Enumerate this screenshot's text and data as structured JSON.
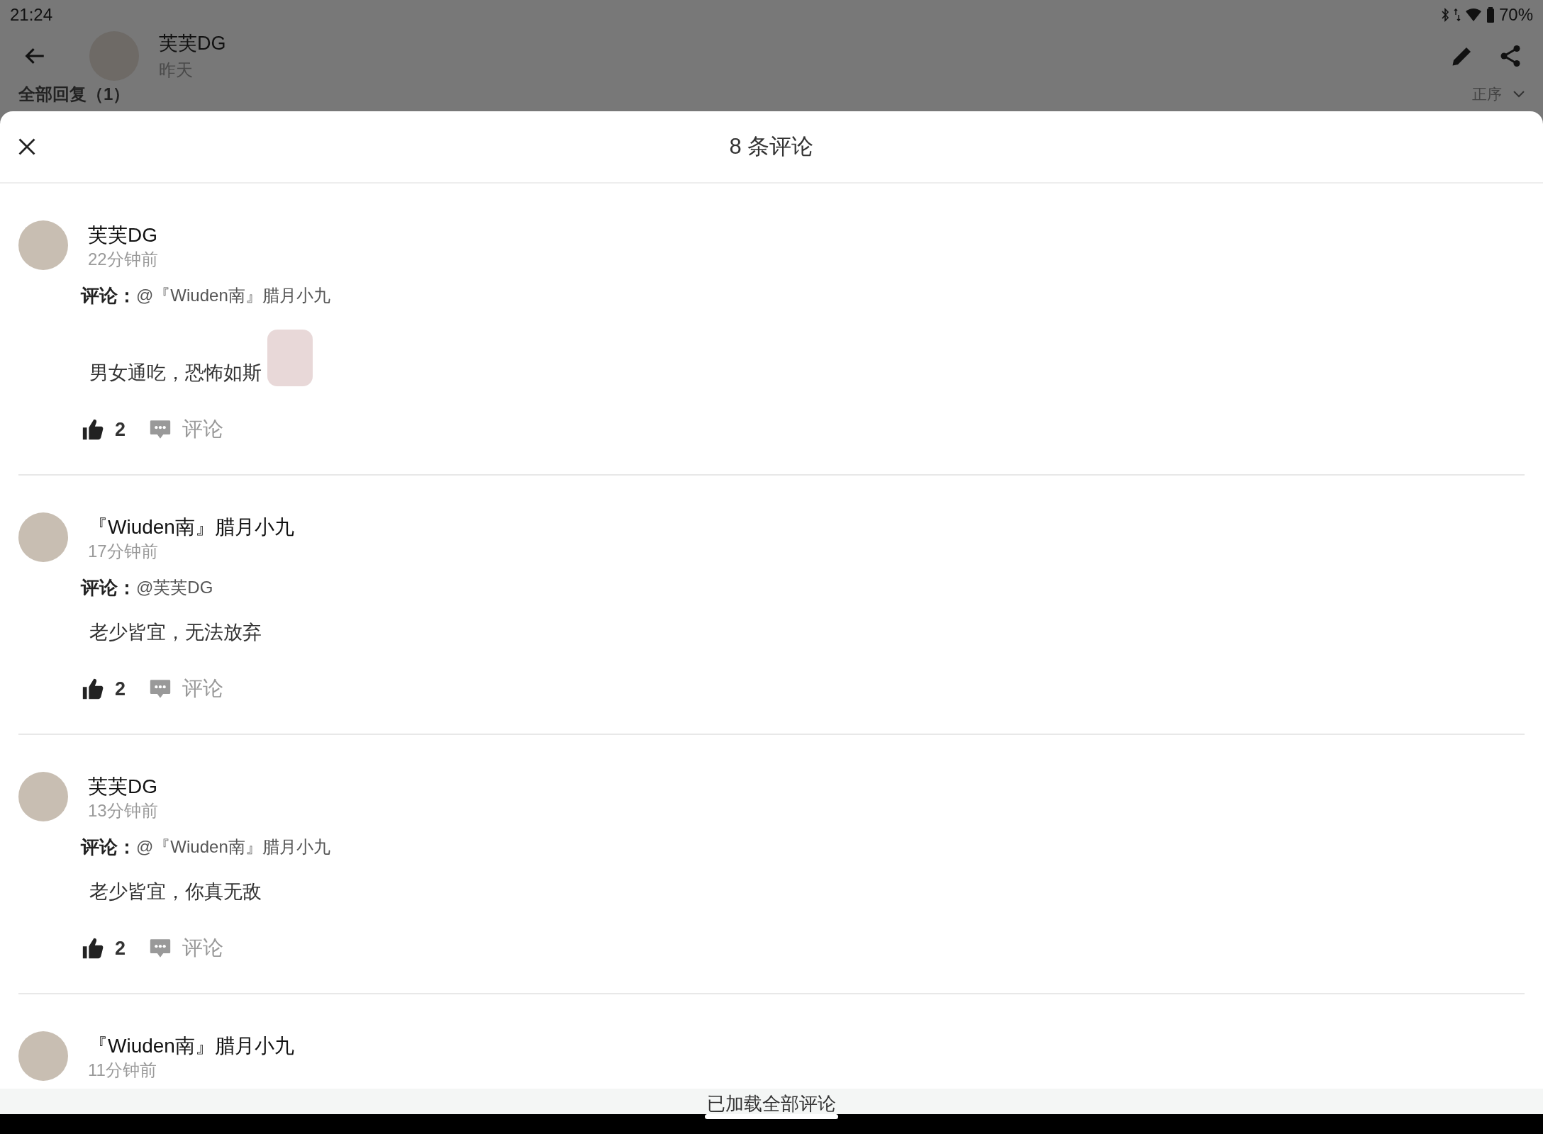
{
  "status_bar": {
    "time": "21:24",
    "battery": "70%"
  },
  "post_header": {
    "author": "芙芙DG",
    "date": "昨天"
  },
  "background_row": {
    "label": "全部回复（1）",
    "sort": "正序"
  },
  "sheet": {
    "title": "8 条评论",
    "footer": "已加载全部评论"
  },
  "comments": [
    {
      "author": "芙芙DG",
      "time": "22分钟前",
      "reply_label": "评论：",
      "reply_to": "@『Wiuden南』腊月小九",
      "text": "男女通吃，恐怖如斯",
      "sticker": true,
      "likes": "2",
      "comment_label": "评论"
    },
    {
      "author": "『Wiuden南』腊月小九",
      "time": "17分钟前",
      "reply_label": "评论：",
      "reply_to": "@芙芙DG",
      "text": "老少皆宜，无法放弃",
      "sticker": false,
      "likes": "2",
      "comment_label": "评论"
    },
    {
      "author": "芙芙DG",
      "time": "13分钟前",
      "reply_label": "评论：",
      "reply_to": "@『Wiuden南』腊月小九",
      "text": "老少皆宜，你真无敌",
      "sticker": false,
      "likes": "2",
      "comment_label": "评论"
    },
    {
      "author": "『Wiuden南』腊月小九",
      "time": "11分钟前"
    }
  ]
}
